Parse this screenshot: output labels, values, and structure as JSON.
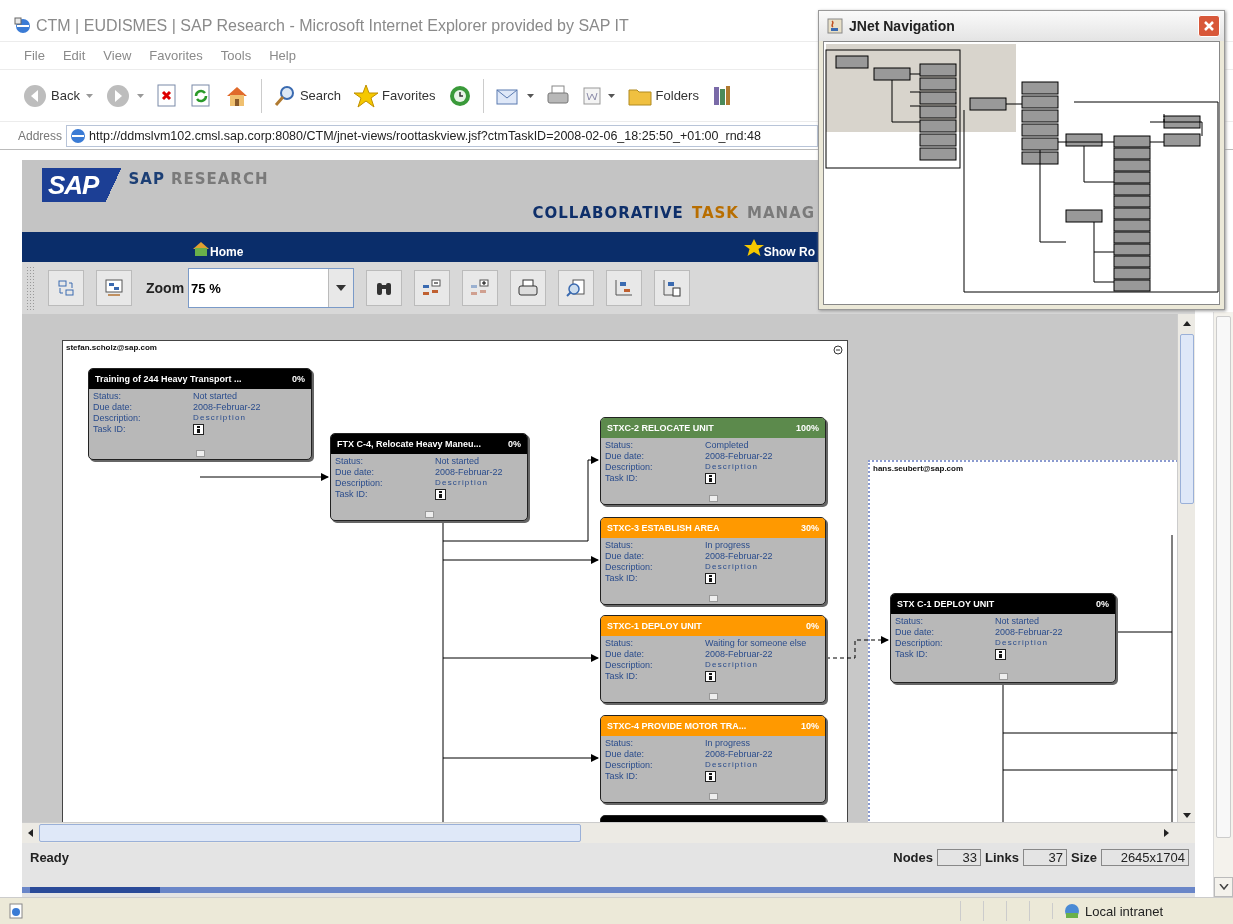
{
  "window": {
    "title": "CTM | EUDISMES | SAP Research - Microsoft Internet Explorer provided by SAP IT"
  },
  "menu": [
    "File",
    "Edit",
    "View",
    "Favorites",
    "Tools",
    "Help"
  ],
  "browser_toolbar": [
    {
      "kind": "back",
      "label": "Back"
    },
    {
      "kind": "forward"
    },
    {
      "kind": "stop"
    },
    {
      "kind": "refresh"
    },
    {
      "kind": "home"
    },
    {
      "kind": "search",
      "label": "Search"
    },
    {
      "kind": "favorites",
      "label": "Favorites"
    },
    {
      "kind": "history"
    },
    {
      "kind": "mail"
    },
    {
      "kind": "print"
    },
    {
      "kind": "edit"
    },
    {
      "kind": "folders",
      "label": "Folders"
    },
    {
      "kind": "library"
    }
  ],
  "address": {
    "label": "Address",
    "url": "http://ddmslvm102.cmsl.sap.corp:8080/CTM/jnet-views/roottaskview.jsf?ctmTaskID=2008-02-06_18:25:50_+01:00_rnd:48"
  },
  "sap_header": {
    "logo": "SAP",
    "brand": "SAP",
    "brand_sub": "RESEARCH",
    "app_title": [
      {
        "text": "COLLABORATIVE",
        "kind": "dark"
      },
      {
        "text": "TASK",
        "kind": "accent"
      },
      {
        "text": "MANAG",
        "kind": "muted"
      }
    ]
  },
  "nav": [
    {
      "label": "Home",
      "kind": "home"
    },
    {
      "label": "Show Ro",
      "kind": "star"
    }
  ],
  "diagram_toolbar": {
    "zoom_label": "Zoom",
    "zoom_value": "75 %"
  },
  "lanes": [
    {
      "owner": "stefan.scholz@sap.com",
      "nodes": [
        {
          "title": "Training of 244 Heavy Transport ...",
          "percent": "0%",
          "color": "#000000",
          "fields": [
            {
              "label": "Status:",
              "value": "Not started"
            },
            {
              "label": "Due date:",
              "value": "2008-Februar-22"
            },
            {
              "label": "Description:",
              "value": "Description",
              "kind": "link"
            },
            {
              "label": "Task ID:",
              "kind": "info"
            }
          ]
        },
        {
          "title": "FTX C-4, Relocate Heavy Maneu...",
          "percent": "0%",
          "color": "#000000",
          "fields": [
            {
              "label": "Status:",
              "value": "Not started"
            },
            {
              "label": "Due date:",
              "value": "2008-Februar-22"
            },
            {
              "label": "Description:",
              "value": "Description",
              "kind": "link"
            },
            {
              "label": "Task ID:",
              "kind": "info"
            }
          ]
        },
        {
          "title": "STXC-2 RELOCATE UNIT",
          "percent": "100%",
          "color": "#5c8a4c",
          "fields": [
            {
              "label": "Status:",
              "value": "Completed"
            },
            {
              "label": "Due date:",
              "value": "2008-Februar-22"
            },
            {
              "label": "Description:",
              "value": "Description",
              "kind": "link"
            },
            {
              "label": "Task ID:",
              "kind": "info"
            }
          ]
        },
        {
          "title": "STXC-3 ESTABLISH AREA",
          "percent": "30%",
          "color": "#ff9900",
          "fields": [
            {
              "label": "Status:",
              "value": "In progress"
            },
            {
              "label": "Due date:",
              "value": "2008-Februar-22"
            },
            {
              "label": "Description:",
              "value": "Description",
              "kind": "link"
            },
            {
              "label": "Task ID:",
              "kind": "info"
            }
          ]
        },
        {
          "title": "STXC-1 DEPLOY UNIT",
          "percent": "0%",
          "color": "#ff9900",
          "fields": [
            {
              "label": "Status:",
              "value": "Waiting for someone else"
            },
            {
              "label": "Due date:",
              "value": "2008-Februar-22"
            },
            {
              "label": "Description:",
              "value": "Description",
              "kind": "link"
            },
            {
              "label": "Task ID:",
              "kind": "info"
            }
          ]
        },
        {
          "title": "STXC-4 PROVIDE MOTOR TRA...",
          "percent": "10%",
          "color": "#ff9900",
          "fields": [
            {
              "label": "Status:",
              "value": "In progress"
            },
            {
              "label": "Due date:",
              "value": "2008-Februar-22"
            },
            {
              "label": "Description:",
              "value": "Description",
              "kind": "link"
            },
            {
              "label": "Task ID:",
              "kind": "info"
            }
          ]
        },
        {
          "color": "#000000"
        }
      ]
    },
    {
      "owner": "hans.seubert@sap.com",
      "nodes": [
        {
          "title": "STX C-1 DEPLOY UNIT",
          "percent": "0%",
          "color": "#000000",
          "fields": [
            {
              "label": "Status:",
              "value": "Not started"
            },
            {
              "label": "Due date:",
              "value": "2008-Februar-22"
            },
            {
              "label": "Description:",
              "value": "Description",
              "kind": "link"
            },
            {
              "label": "Task ID:",
              "kind": "info"
            }
          ]
        }
      ]
    }
  ],
  "status_bar": {
    "state": "Ready",
    "nodes_label": "Nodes",
    "nodes": "33",
    "links_label": "Links",
    "links": "37",
    "size_label": "Size",
    "size": "2645x1704"
  },
  "ie_status": {
    "zone": "Local intranet"
  },
  "navigator": {
    "title": "JNet Navigation"
  }
}
